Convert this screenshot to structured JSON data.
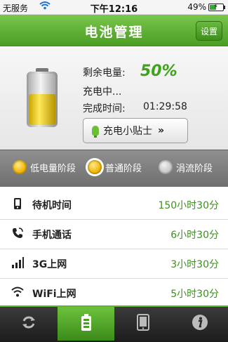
{
  "status": {
    "carrier": "无服务",
    "time": "下午12:16",
    "battery": "49%"
  },
  "header": {
    "title": "电池管理",
    "settings": "设置"
  },
  "info": {
    "remaining_label": "剩余电量:",
    "remaining_value": "50%",
    "charging": "充电中...",
    "finish_label": "完成时间:",
    "finish_value": "01:29:58",
    "tips": "充电小贴士",
    "tips_chevron": "»"
  },
  "stages": [
    {
      "label": "低电量阶段"
    },
    {
      "label": "普通阶段"
    },
    {
      "label": "涓流阶段"
    }
  ],
  "rows": [
    {
      "icon": "phone-standby-icon",
      "name": "待机时间",
      "value": "150小时30分"
    },
    {
      "icon": "phone-call-icon",
      "name": "手机通话",
      "value": "6小时30分"
    },
    {
      "icon": "signal-bars-icon",
      "name": "3G上网",
      "value": "3小时30分"
    },
    {
      "icon": "wifi-icon",
      "name": "WiFi上网",
      "value": "5小时30分"
    }
  ],
  "tabs": [
    {
      "icon": "refresh-icon"
    },
    {
      "icon": "battery-icon"
    },
    {
      "icon": "tablet-icon"
    },
    {
      "icon": "info-icon"
    }
  ],
  "colors": {
    "accent": "#5fb32f",
    "value_green": "#3d8f1e"
  }
}
